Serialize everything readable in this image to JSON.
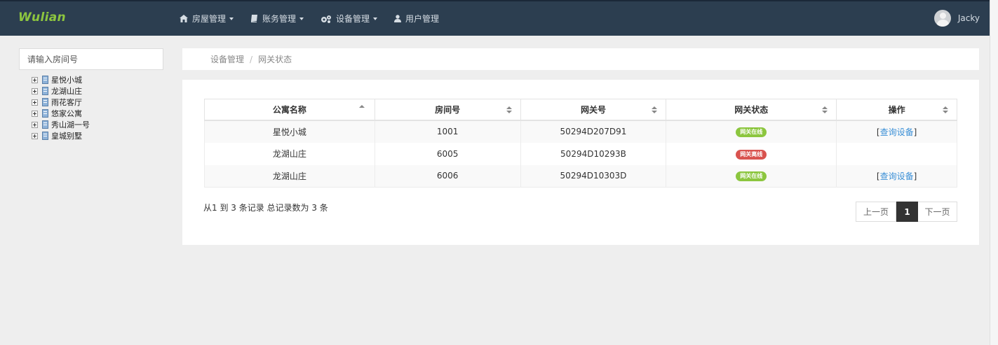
{
  "app": {
    "logo": "Wulian"
  },
  "nav": [
    {
      "label": "房屋管理",
      "icon": "home-icon",
      "dropdown": true
    },
    {
      "label": "账务管理",
      "icon": "book-icon",
      "dropdown": true
    },
    {
      "label": "设备管理",
      "icon": "gears-icon",
      "dropdown": true
    },
    {
      "label": "用户管理",
      "icon": "user-icon",
      "dropdown": false
    }
  ],
  "user": {
    "name": "Jacky"
  },
  "sidebar": {
    "search_placeholder": "请输入房间号",
    "tree": [
      "星悦小城",
      "龙湖山庄",
      "雨花客厅",
      "悠家公寓",
      "秀山湖一号",
      "皇城别墅"
    ]
  },
  "breadcrumb": {
    "parent": "设备管理",
    "separator": "/",
    "current": "网关状态"
  },
  "table": {
    "columns": [
      "公寓名称",
      "房间号",
      "网关号",
      "网关状态",
      "操作"
    ],
    "rows": [
      {
        "apartment": "星悦小城",
        "room": "1001",
        "gateway": "50294D207D91",
        "status": "网关在线",
        "status_type": "online",
        "action": "查询设备"
      },
      {
        "apartment": "龙湖山庄",
        "room": "6005",
        "gateway": "50294D10293B",
        "status": "网关离线",
        "status_type": "offline",
        "action": ""
      },
      {
        "apartment": "龙湖山庄",
        "room": "6006",
        "gateway": "50294D10303D",
        "status": "网关在线",
        "status_type": "online",
        "action": "查询设备"
      }
    ]
  },
  "footer": {
    "summary": "从1 到 3 条记录 总记录数为 3 条",
    "prev": "上一页",
    "page": "1",
    "next": "下一页"
  },
  "colors": {
    "topbar": "#2c3e50",
    "logo": "#8dc63f",
    "online": "#8cc63f",
    "offline": "#d9534f",
    "link": "#3a8fd6"
  }
}
